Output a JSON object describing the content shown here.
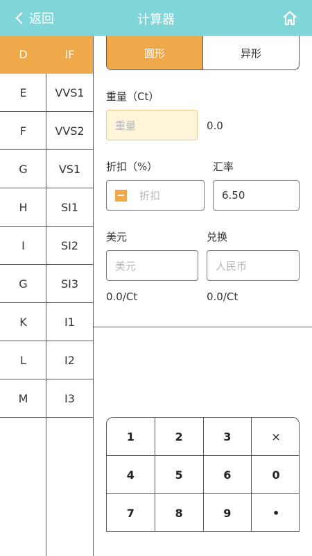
{
  "header": {
    "back_label": "返回",
    "title": "计算器",
    "bg_color": "#7fd5d8"
  },
  "table": {
    "head": [
      "D",
      "IF"
    ],
    "rows": [
      [
        "E",
        "VVS1"
      ],
      [
        "F",
        "VVS2"
      ],
      [
        "G",
        "VS1"
      ],
      [
        "H",
        "SI1"
      ],
      [
        "I",
        "SI2"
      ],
      [
        "G",
        "SI3"
      ],
      [
        "K",
        "I1"
      ],
      [
        "L",
        "I2"
      ],
      [
        "M",
        "I3"
      ]
    ]
  },
  "tabs": {
    "round": "圆形",
    "fancy": "异形",
    "active": "圆形",
    "accent_color": "#f0a94a"
  },
  "form": {
    "weight_label": "重量（Ct）",
    "weight_placeholder": "重量",
    "weight_result": "0.0",
    "discount_label": "折扣（%）",
    "discount_placeholder": "折扣",
    "rate_label": "汇率",
    "rate_value": "6.50",
    "usd_label": "美元",
    "usd_placeholder": "美元",
    "convert_label": "兑换",
    "rmb_placeholder": "人民币",
    "usd_per_ct": "0.0/Ct",
    "rmb_per_ct": "0.0/Ct"
  },
  "keypad": [
    "1",
    "2",
    "3",
    "×",
    "4",
    "5",
    "6",
    "0",
    "7",
    "8",
    "9",
    "•"
  ]
}
